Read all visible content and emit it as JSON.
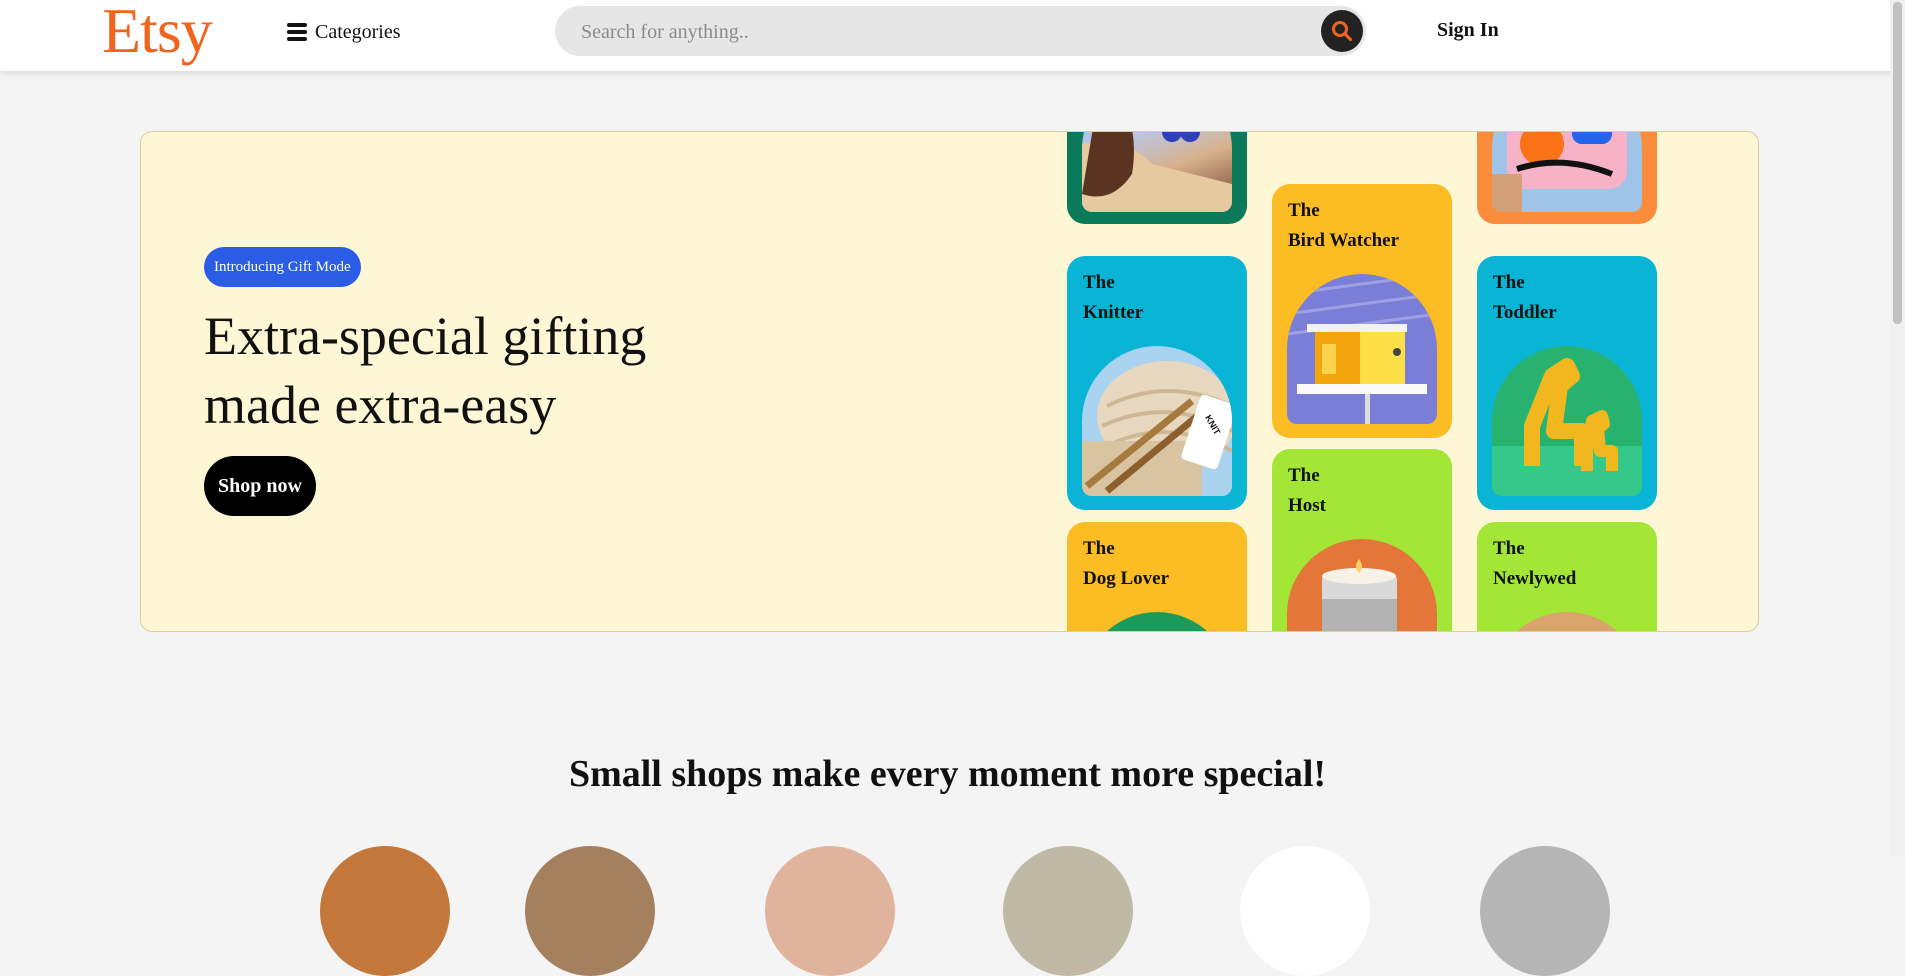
{
  "header": {
    "logo": "Etsy",
    "categories_label": "Categories",
    "search_placeholder": "Search for anything..",
    "sign_in": "Sign In"
  },
  "hero": {
    "badge": "Introducing Gift Mode",
    "headline": "Extra-special gifting made extra-easy",
    "cta": "Shop now",
    "cards": [
      {
        "title": "The\nKnitter"
      },
      {
        "title": "The\nDog Lover"
      },
      {
        "title": "The\nBird Watcher"
      },
      {
        "title": "The\nHost"
      },
      {
        "title": "The\nToddler"
      },
      {
        "title": "The\nNewlywed"
      }
    ]
  },
  "section": {
    "title": "Small shops make every moment more special!"
  },
  "colors": {
    "brand": "#f1641e",
    "badge": "#2a5ce6",
    "banner_bg": "#fdf7d6"
  }
}
